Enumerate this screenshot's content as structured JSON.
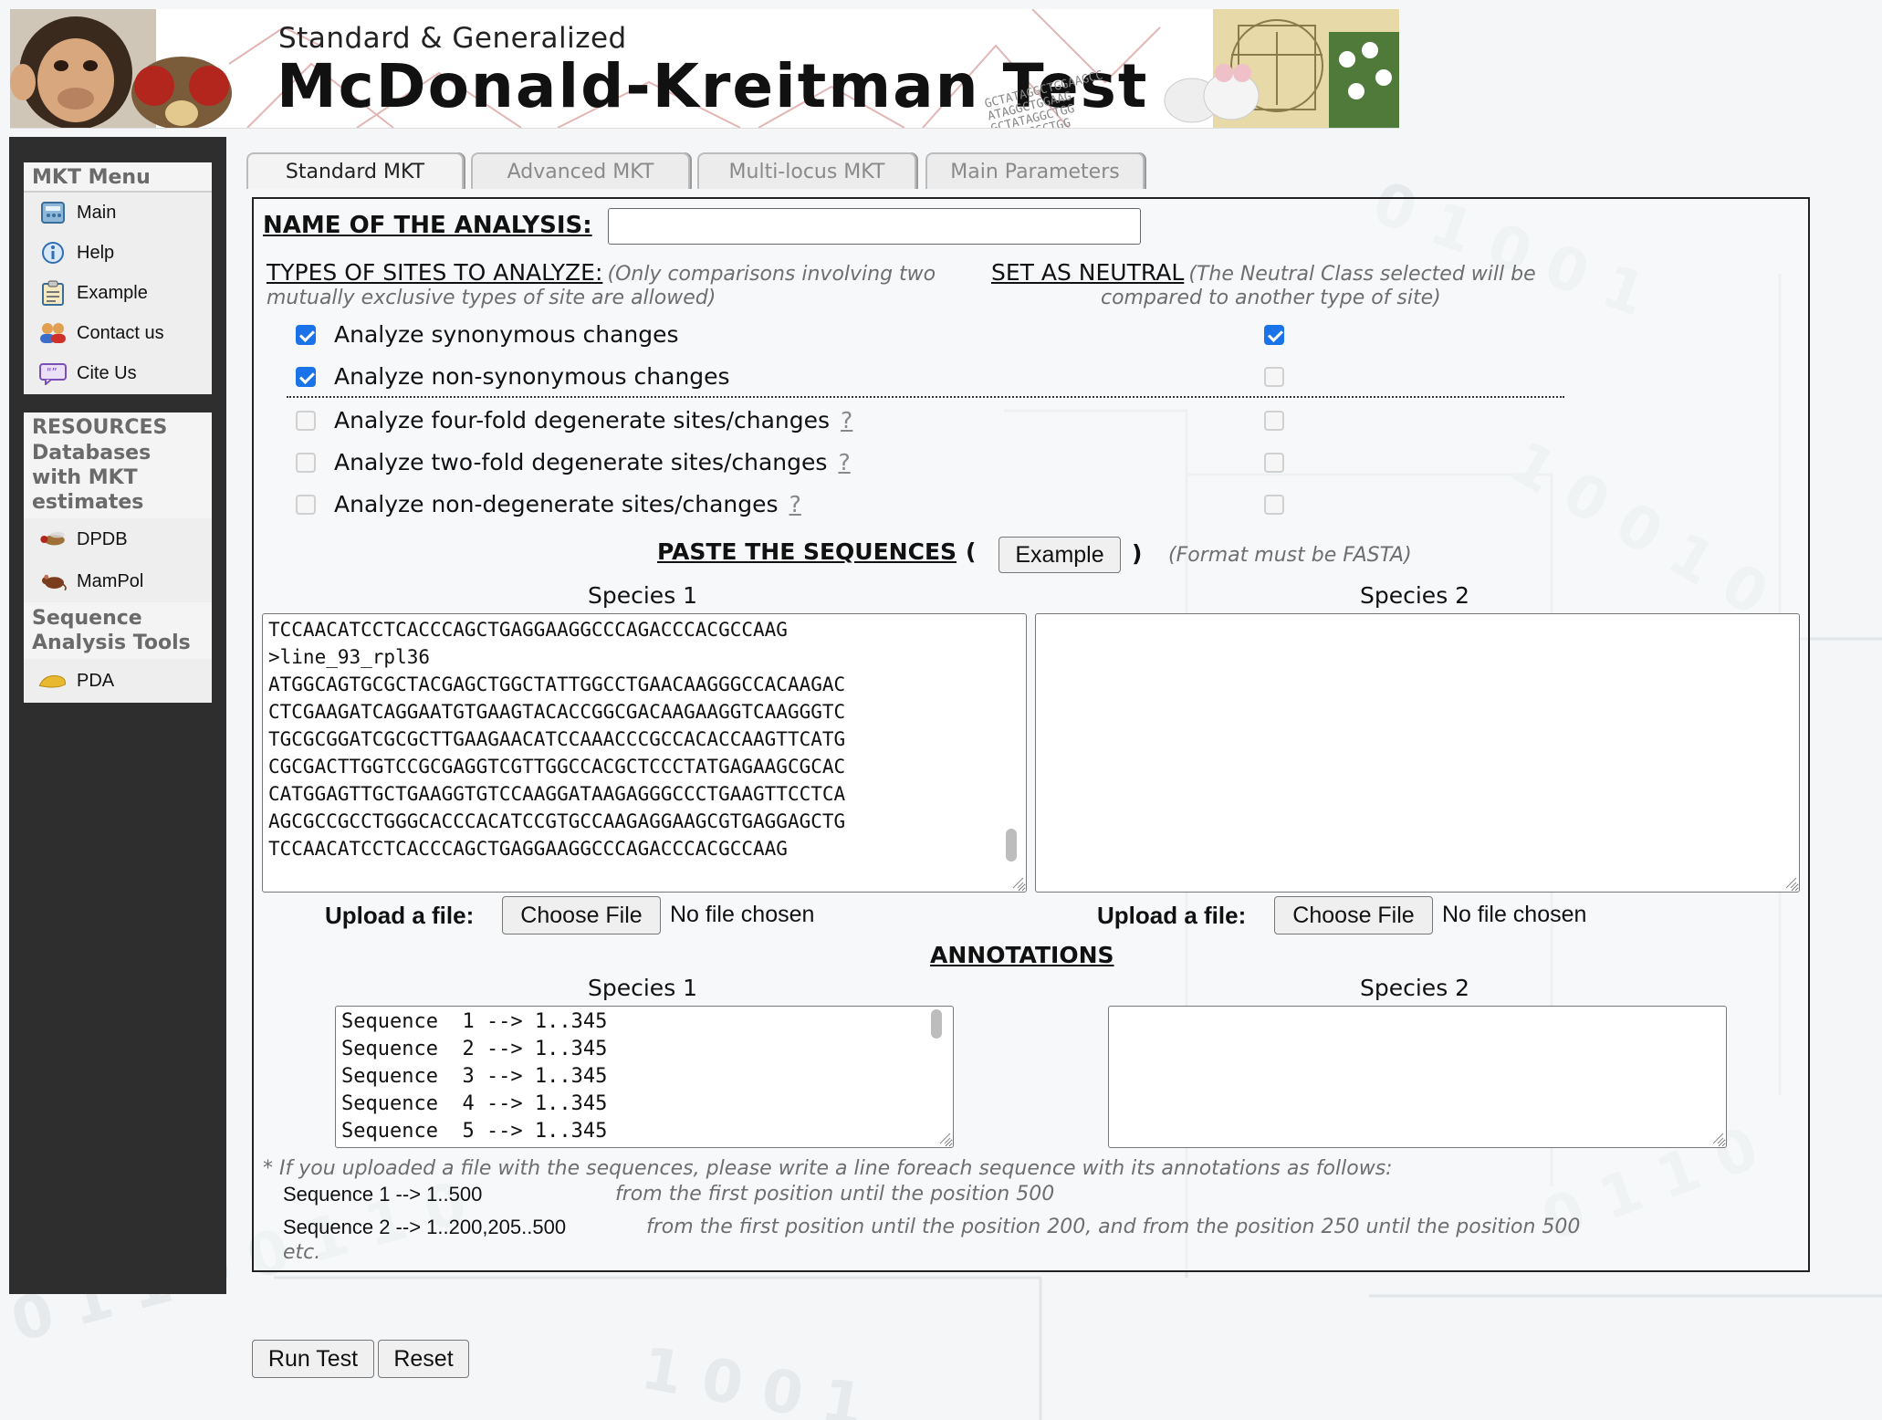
{
  "banner": {
    "subtitle": "Standard & Generalized",
    "title": "McDonald-Kreitman Test",
    "dna_text": "GCTATAGGCTGGAAGCC\nATAGGCTGGAAG\nGCTATAGGCTGG\nCTATACGCTGG"
  },
  "menu": {
    "header": "MKT Menu",
    "items": [
      {
        "label": "Main",
        "icon": "calculator-icon"
      },
      {
        "label": "Help",
        "icon": "info-icon"
      },
      {
        "label": "Example",
        "icon": "clipboard-icon"
      },
      {
        "label": "Contact us",
        "icon": "people-icon"
      },
      {
        "label": "Cite Us",
        "icon": "quote-icon"
      }
    ],
    "resources_header": "RESOURCES",
    "databases_label": "Databases with MKT estimates",
    "databases": [
      {
        "label": "DPDB",
        "icon": "fly-icon"
      },
      {
        "label": "MamPol",
        "icon": "mouse-icon"
      }
    ],
    "tools_label": "Sequence Analysis Tools",
    "tools": [
      {
        "label": "PDA",
        "icon": "pda-icon"
      }
    ]
  },
  "tabs": [
    {
      "label": "Standard MKT",
      "active": true
    },
    {
      "label": "Advanced MKT",
      "active": false
    },
    {
      "label": "Multi-locus MKT",
      "active": false
    },
    {
      "label": "Main Parameters",
      "active": false
    }
  ],
  "form": {
    "name_label": "NAME OF THE ANALYSIS:",
    "name_value": "",
    "types_label": "TYPES OF SITES TO ANALYZE:",
    "types_note_1": "(Only comparisons involving two",
    "types_note_2": "mutually exclusive types of site are allowed)",
    "neutral_label": "SET AS NEUTRAL",
    "neutral_note_1": "(The Neutral Class selected will be",
    "neutral_note_2": "compared to another type of site)",
    "help_mark": "?",
    "site_types": [
      {
        "label": "Analyze synonymous changes",
        "checked": true,
        "neutral": true,
        "help": false
      },
      {
        "label": "Analyze non-synonymous changes",
        "checked": true,
        "neutral": false,
        "help": false
      },
      {
        "label": "Analyze four-fold degenerate sites/changes",
        "checked": false,
        "neutral": false,
        "help": true
      },
      {
        "label": "Analyze two-fold degenerate sites/changes",
        "checked": false,
        "neutral": false,
        "help": true
      },
      {
        "label": "Analyze non-degenerate sites/changes",
        "checked": false,
        "neutral": false,
        "help": true
      }
    ],
    "paste_label": "PASTE THE SEQUENCES",
    "paste_open": "(",
    "paste_close": ")",
    "example_button": "Example",
    "format_note": "(Format must be FASTA)",
    "species1_label": "Species 1",
    "species2_label": "Species 2",
    "species1_sequences": "TCCAACATCCTCACCCAGCTGAGGAAGGCCCAGACCCACGCCAAG\n>line_93_rpl36\nATGGCAGTGCGCTACGAGCTGGCTATTGGCCTGAACAAGGGCCACAAGAC\nCTCGAAGATCAGGAATGTGAAGTACACCGGCGACAAGAAGGTCAAGGGTC\nTGCGCGGATCGCGCTTGAAGAACATCCAAACCCGCCACACCAAGTTCATG\nCGCGACTTGGTCCGCGAGGTCGTTGGCCACGCTCCCTATGAGAAGCGCAC\nCATGGAGTTGCTGAAGGTGTCCAAGGATAAGAGGGCCCTGAAGTTCCTCA\nAGCGCCGCCTGGGCACCCACATCCGTGCCAAGAGGAAGCGTGAGGAGCTG\nTCCAACATCCTCACCCAGCTGAGGAAGGCCCAGACCCACGCCAAG",
    "species2_sequences": "",
    "upload_label": "Upload a file",
    "upload_colon": ":",
    "choose_file": "Choose File",
    "no_file": "No file chosen",
    "annotations_label": "ANNOTATIONS",
    "annotations_species1": "Sequence  1 --> 1..345\nSequence  2 --> 1..345\nSequence  3 --> 1..345\nSequence  4 --> 1..345\nSequence  5 --> 1..345",
    "annotations_species2": "",
    "annot_note": "* If you uploaded a file with the sequences, please write a line foreach sequence with its annotations as follows:",
    "example1_code": "Sequence 1 --> 1..500",
    "example1_desc": "from the first position until the position 500",
    "example2_code": "Sequence 2 --> 1..200,205..500",
    "example2_desc": "from the first position until the position 200, and from the position 250 until the position 500",
    "etc": "etc."
  },
  "actions": {
    "run": "Run Test",
    "reset": "Reset"
  },
  "colors": {
    "accent_checkbox": "#1a73e8",
    "sidebar_bg": "#2e2e2e"
  }
}
